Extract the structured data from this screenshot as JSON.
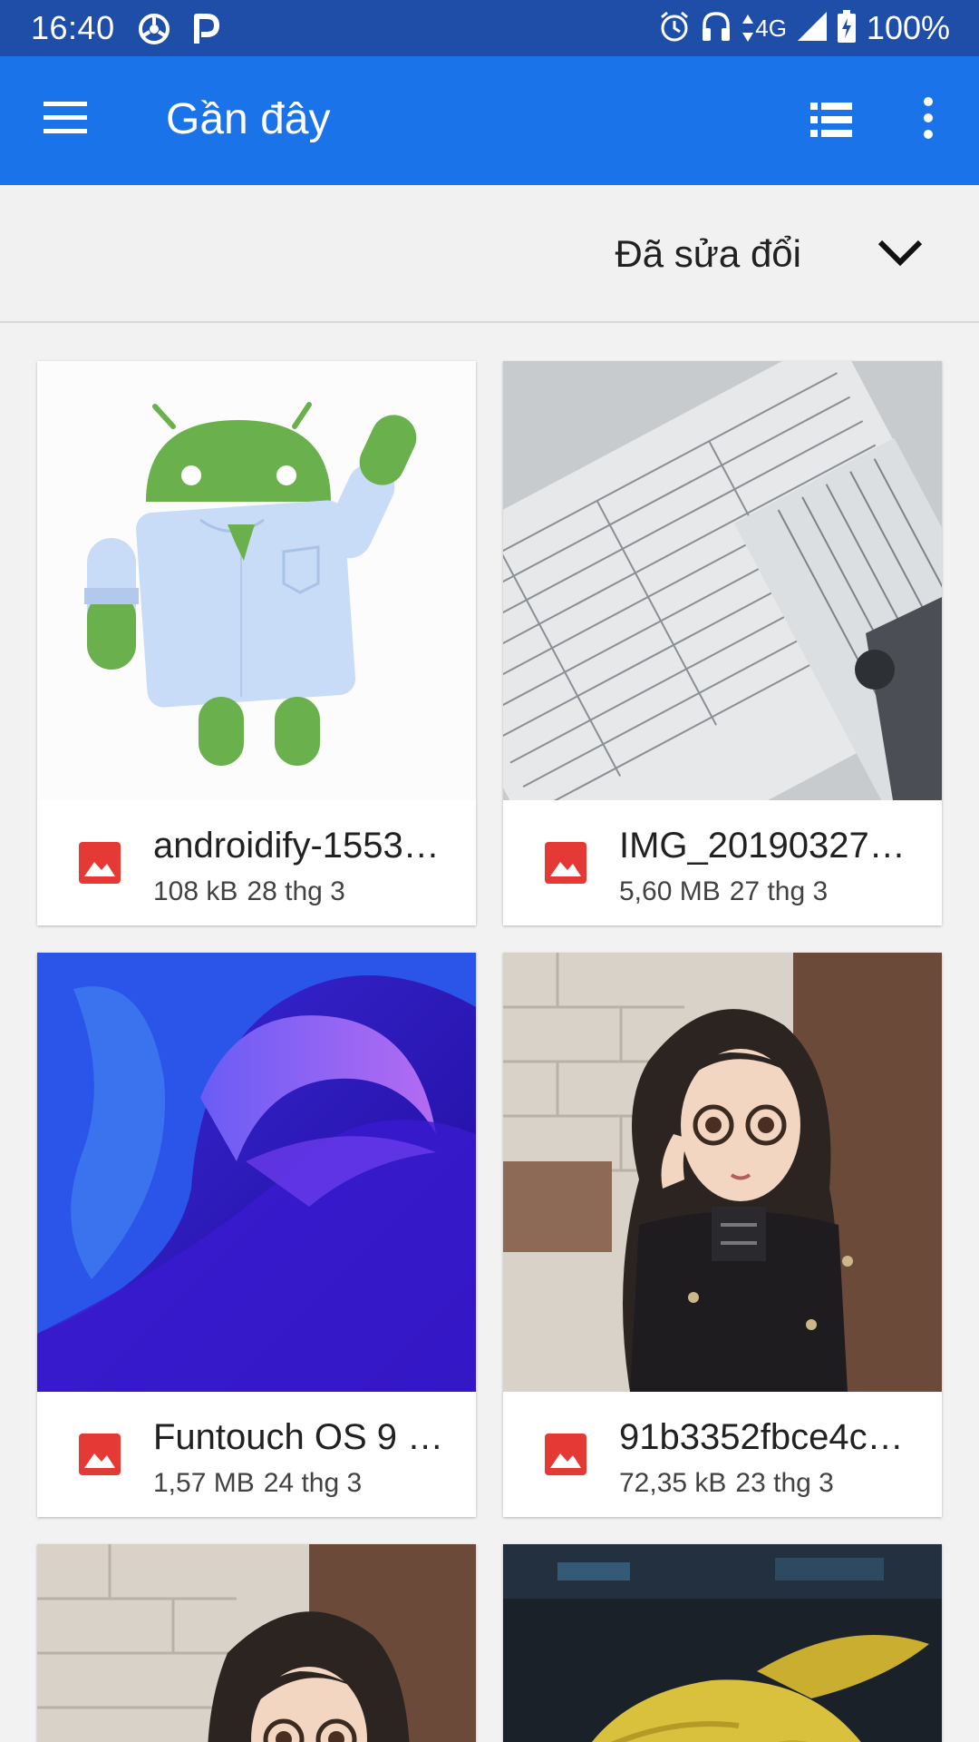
{
  "status_bar": {
    "time": "16:40",
    "network": "4G",
    "battery": "100%",
    "icons": [
      "settings-wheel-icon",
      "parking-icon",
      "alarm-icon",
      "headset-icon",
      "signal-icon",
      "battery-charging-icon"
    ]
  },
  "app_bar": {
    "title": "Gần đây",
    "menu_icon": "hamburger-menu-icon",
    "view_icon": "list-view-icon",
    "overflow_icon": "more-vert-icon"
  },
  "sort": {
    "label": "Đã sửa đổi",
    "icon": "chevron-down-icon"
  },
  "files": [
    {
      "name": "androidify-1553…",
      "size": "108 kB",
      "date": "28 thg 3",
      "icon": "image-file-icon"
    },
    {
      "name": "IMG_20190327_…",
      "size": "5,60 MB",
      "date": "27 thg 3",
      "icon": "image-file-icon"
    },
    {
      "name": "Funtouch OS 9 …",
      "size": "1,57 MB",
      "date": "24 thg 3",
      "icon": "image-file-icon"
    },
    {
      "name": "91b3352fbce4c…",
      "size": "72,35 kB",
      "date": "23 thg 3",
      "icon": "image-file-icon"
    }
  ],
  "colors": {
    "status_bar": "#1f4ea8",
    "app_bar": "#1a73e8",
    "file_icon": "#e53935",
    "android_green": "#6ab04c"
  }
}
